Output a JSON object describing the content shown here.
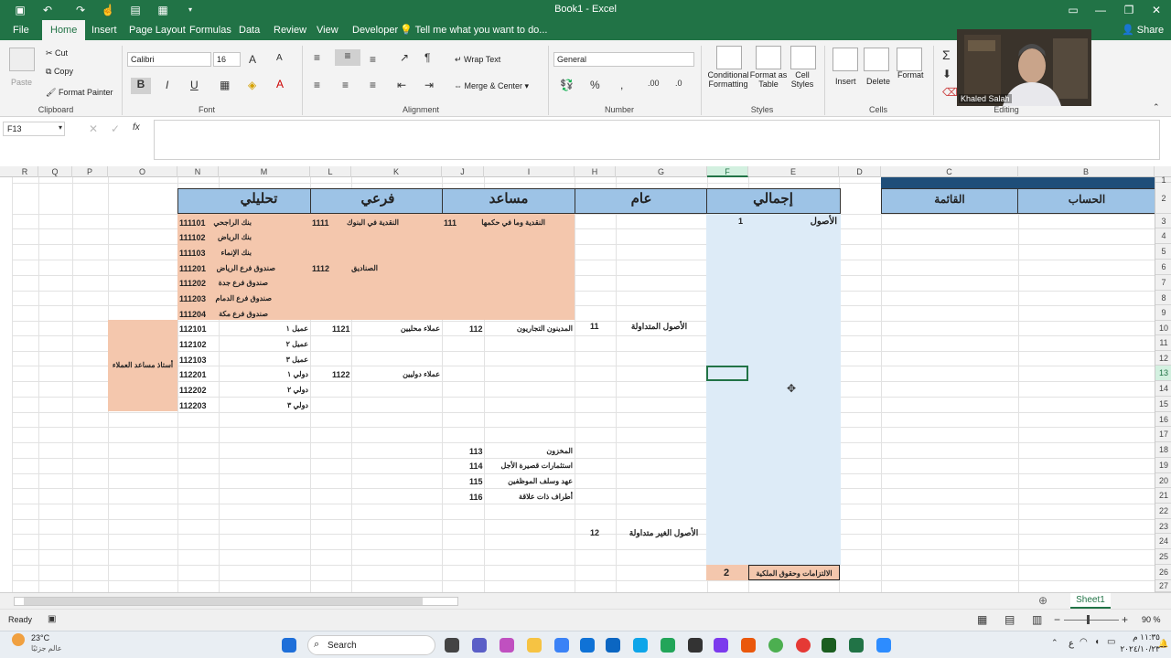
{
  "window": {
    "title": "Book1 - Excel"
  },
  "menu_tabs": [
    "File",
    "Home",
    "Insert",
    "Page Layout",
    "Formulas",
    "Data",
    "View",
    "Review",
    "Developer"
  ],
  "tell_me": "Tell me what you want to do...",
  "share": "Share",
  "ribbon": {
    "clipboard": {
      "paste": "Paste",
      "cut": "Cut",
      "copy": "Copy",
      "format_painter": "Format Painter",
      "label": "Clipboard"
    },
    "font": {
      "name": "Calibri",
      "size": "16",
      "label": "Font"
    },
    "alignment": {
      "wrap_text": "Wrap Text",
      "merge_center": "Merge & Center",
      "label": "Alignment"
    },
    "number": {
      "format": "General",
      "label": "Number"
    },
    "styles": {
      "conditional": "Conditional Formatting",
      "format_table": "Format as Table",
      "cell_styles": "Cell Styles",
      "label": "Styles"
    },
    "cells": {
      "insert": "Insert",
      "delete": "Delete",
      "format": "Format",
      "label": "Cells"
    },
    "editing": {
      "label": "Editing"
    }
  },
  "name_box": "F13",
  "video_overlay": {
    "name": "Khaled Salah"
  },
  "columns": [
    "R",
    "Q",
    "P",
    "O",
    "N",
    "M",
    "L",
    "K",
    "J",
    "I",
    "H",
    "G",
    "F",
    "E",
    "D",
    "C",
    "B"
  ],
  "rows": [
    "1",
    "2",
    "3",
    "4",
    "5",
    "6",
    "7",
    "8",
    "9",
    "10",
    "11",
    "12",
    "13",
    "14",
    "15",
    "16",
    "17",
    "18",
    "19",
    "20",
    "21",
    "22",
    "23",
    "24",
    "25",
    "26",
    "27"
  ],
  "sheet": {
    "headers": {
      "analytical": "تحليلي",
      "sub": "فرعي",
      "assistant": "مساعد",
      "general": "عام",
      "total": "إجمالي",
      "list": "القائمة",
      "account": "الحساب"
    },
    "assets": {
      "label": "الأصول",
      "code": "1"
    },
    "current_assets": {
      "label": "الأصول المتداولة",
      "code": "11"
    },
    "noncurrent_assets": {
      "label": "الأصول الغير متداولة",
      "code": "12"
    },
    "liabilities": {
      "label": "الالتزامات وحقوق الملكية",
      "code": "2"
    },
    "customers_ledger": "أستاذ مساعد العملاء",
    "assistant_items": [
      {
        "code": "111",
        "label": "النقدية وما في حكمها"
      },
      {
        "code": "112",
        "label": "المدينون التجاريون"
      },
      {
        "code": "113",
        "label": "المخزون"
      },
      {
        "code": "114",
        "label": "استثمارات قصيرة الأجل"
      },
      {
        "code": "115",
        "label": "عهد وسلف الموظفين"
      },
      {
        "code": "116",
        "label": "أطراف ذات علاقة"
      }
    ],
    "sub_items": [
      {
        "code": "1111",
        "label": "النقدية في البنوك"
      },
      {
        "code": "1112",
        "label": "الصناديق"
      },
      {
        "code": "1121",
        "label": "عملاء محليين"
      },
      {
        "code": "1122",
        "label": "عملاء دوليين"
      }
    ],
    "analytic_items": [
      {
        "code": "111101",
        "label": "بنك الراجحي"
      },
      {
        "code": "111102",
        "label": "بنك الرياض"
      },
      {
        "code": "111103",
        "label": "بنك الإنماء"
      },
      {
        "code": "111201",
        "label": "صندوق فرع الرياض"
      },
      {
        "code": "111202",
        "label": "صندوق فرع جدة"
      },
      {
        "code": "111203",
        "label": "صندوق فرع الدمام"
      },
      {
        "code": "111204",
        "label": "صندوق فرع مكة"
      },
      {
        "code": "112101",
        "label": "عميل ١"
      },
      {
        "code": "112102",
        "label": "عميل ٢"
      },
      {
        "code": "112103",
        "label": "عميل ٣"
      },
      {
        "code": "112201",
        "label": "دولي ١"
      },
      {
        "code": "112202",
        "label": "دولي ٢"
      },
      {
        "code": "112203",
        "label": "دولي ٣"
      }
    ]
  },
  "sheet_tab": "Sheet1",
  "status": {
    "ready": "Ready",
    "zoom": "90 %"
  },
  "taskbar": {
    "weather_temp": "23°C",
    "weather_desc": "عالم جزئيًا",
    "search": "Search",
    "time": "١١:٣٥ م",
    "date": "٢٠٢٤/١٠/٢٣",
    "lang": "ع"
  },
  "colors": {
    "accent": "#217346",
    "header_blue": "#9dc3e6",
    "salmon": "#f4c7ad",
    "light_blue": "#ddebf7",
    "banner": "#1f4e79"
  }
}
